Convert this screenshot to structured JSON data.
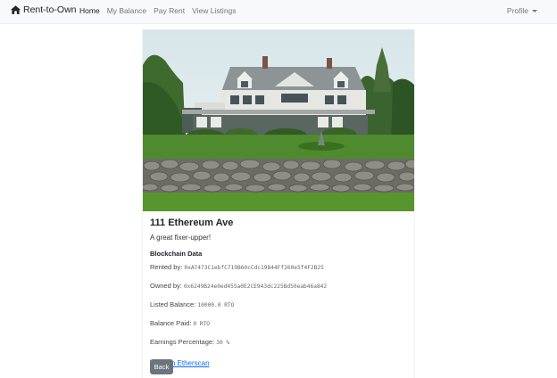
{
  "navbar": {
    "brand": "Rent-to-Own",
    "brand_icon": "home-icon",
    "links": [
      "Home",
      "My Balance",
      "Pay Rent",
      "View Listings"
    ],
    "active_link": "Home",
    "profile_label": "Profile"
  },
  "listing": {
    "photo_alt": "",
    "title": "111 Ethereum Ave",
    "description": "A great fixer-upper!",
    "section_title": "Blockchain Data",
    "rented_by_label": "Rented by:",
    "rented_by_value": "0xA7473C1ebfC719B60cCdc19844Ff260e5f4F2B25",
    "owned_by_label": "Owned by:",
    "owned_by_value": "0x6249B24e0ed455a0E2CE943dc225BdS0eab46a842",
    "listed_balance_label": "Listed Balance:",
    "listed_balance_value": "10000.0 RTO",
    "balance_paid_label": "Balance Paid:",
    "balance_paid_value": "0 RTO",
    "earnings_label": "Earnings Percentage:",
    "earnings_value": "30 %",
    "etherscan_link": "View on Etherscan",
    "back_button": "Back"
  },
  "colors": {
    "navbar_bg": "#f8f9fa",
    "link_blue": "#0d6efd",
    "back_button_bg": "#6c757d"
  }
}
